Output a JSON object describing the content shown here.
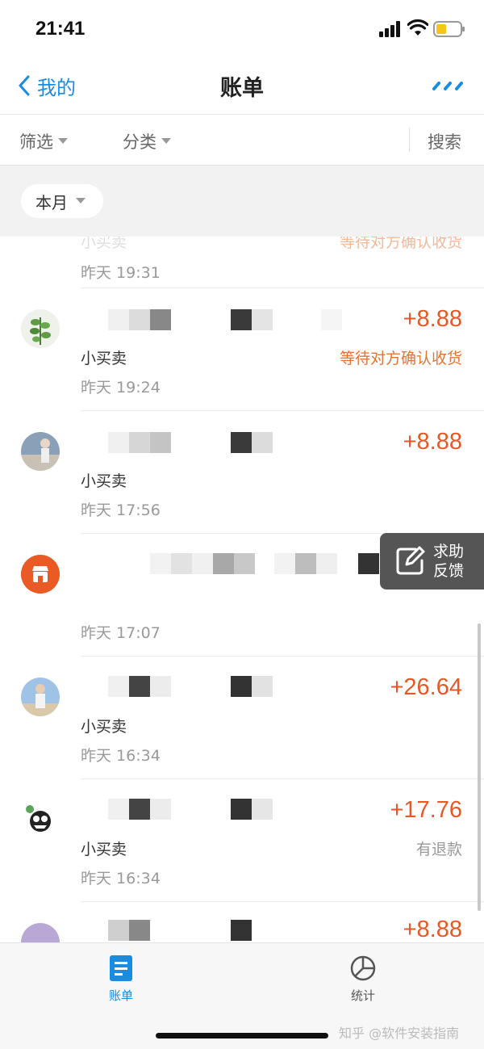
{
  "status_bar": {
    "time": "21:41"
  },
  "nav": {
    "back_label": "我的",
    "title": "账单"
  },
  "filters": {
    "filter_label": "筛选",
    "category_label": "分类",
    "search_label": "搜索"
  },
  "month_chip": "本月",
  "colors": {
    "accent": "#1a8bdf",
    "amount": "#e65826",
    "status_orange": "#e8732f",
    "muted": "#999999"
  },
  "transactions": [
    {
      "title": "",
      "amount": "",
      "subtitle": "小买卖",
      "status": "等待对方确认收货",
      "time": "昨天  19:31"
    },
    {
      "title": "",
      "amount": "+8.88",
      "subtitle": "小买卖",
      "status": "等待对方确认收货",
      "time": "昨天  19:24"
    },
    {
      "title": "",
      "amount": "+8.88",
      "subtitle": "小买卖",
      "status": "",
      "time": "昨天  17:56"
    },
    {
      "title": "",
      "amount": "",
      "subtitle": "",
      "status": "",
      "time": "昨天  17:07"
    },
    {
      "title": "",
      "amount": "+26.64",
      "subtitle": "小买卖",
      "status": "",
      "time": "昨天  16:34"
    },
    {
      "title": "",
      "amount": "+17.76",
      "subtitle": "小买卖",
      "status": "有退款",
      "time": "昨天  16:34"
    },
    {
      "title": "",
      "amount": "+8.88",
      "subtitle": "",
      "status": "",
      "time": ""
    }
  ],
  "feedback": {
    "line1": "求助",
    "line2": "反馈"
  },
  "tabs": [
    {
      "label": "账单",
      "icon": "bill-icon",
      "active": true
    },
    {
      "label": "统计",
      "icon": "pie-chart-icon",
      "active": false
    }
  ],
  "watermark": "知乎 @软件安装指南"
}
